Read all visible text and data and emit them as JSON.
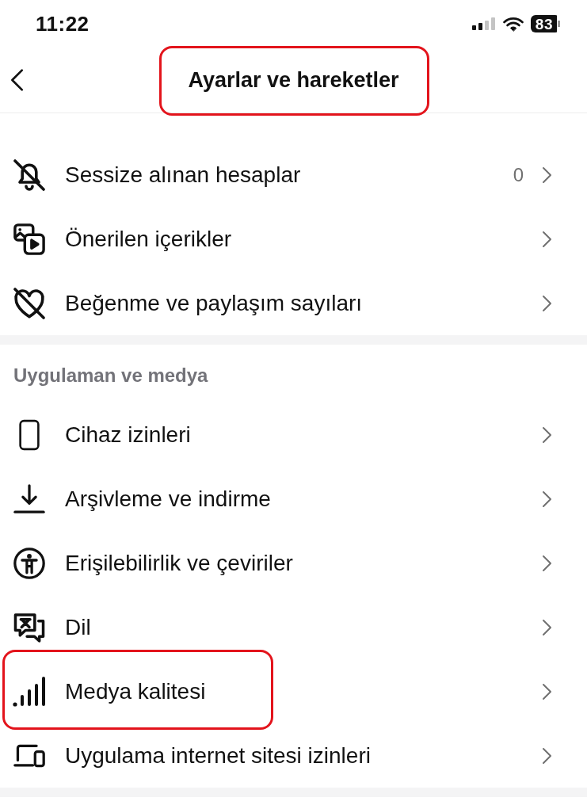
{
  "status_bar": {
    "time": "11:22",
    "battery": "83"
  },
  "header": {
    "title": "Ayarlar ve hareketler",
    "highlighted": true
  },
  "sections": [
    {
      "items": [
        {
          "label": "Sessize alınan hesaplar",
          "count": "0",
          "highlighted": false
        },
        {
          "label": "Önerilen içerikler",
          "highlighted": false
        },
        {
          "label": "Beğenme ve paylaşım sayıları",
          "highlighted": false
        }
      ]
    },
    {
      "title": "Uygulaman ve medya",
      "items": [
        {
          "label": "Cihaz izinleri",
          "highlighted": false
        },
        {
          "label": "Arşivleme ve indirme",
          "highlighted": false
        },
        {
          "label": "Erişilebilirlik ve çeviriler",
          "highlighted": false
        },
        {
          "label": "Dil",
          "highlighted": false
        },
        {
          "label": "Medya kalitesi",
          "highlighted": true
        },
        {
          "label": "Uygulama internet sitesi izinleri",
          "highlighted": false
        }
      ]
    }
  ]
}
